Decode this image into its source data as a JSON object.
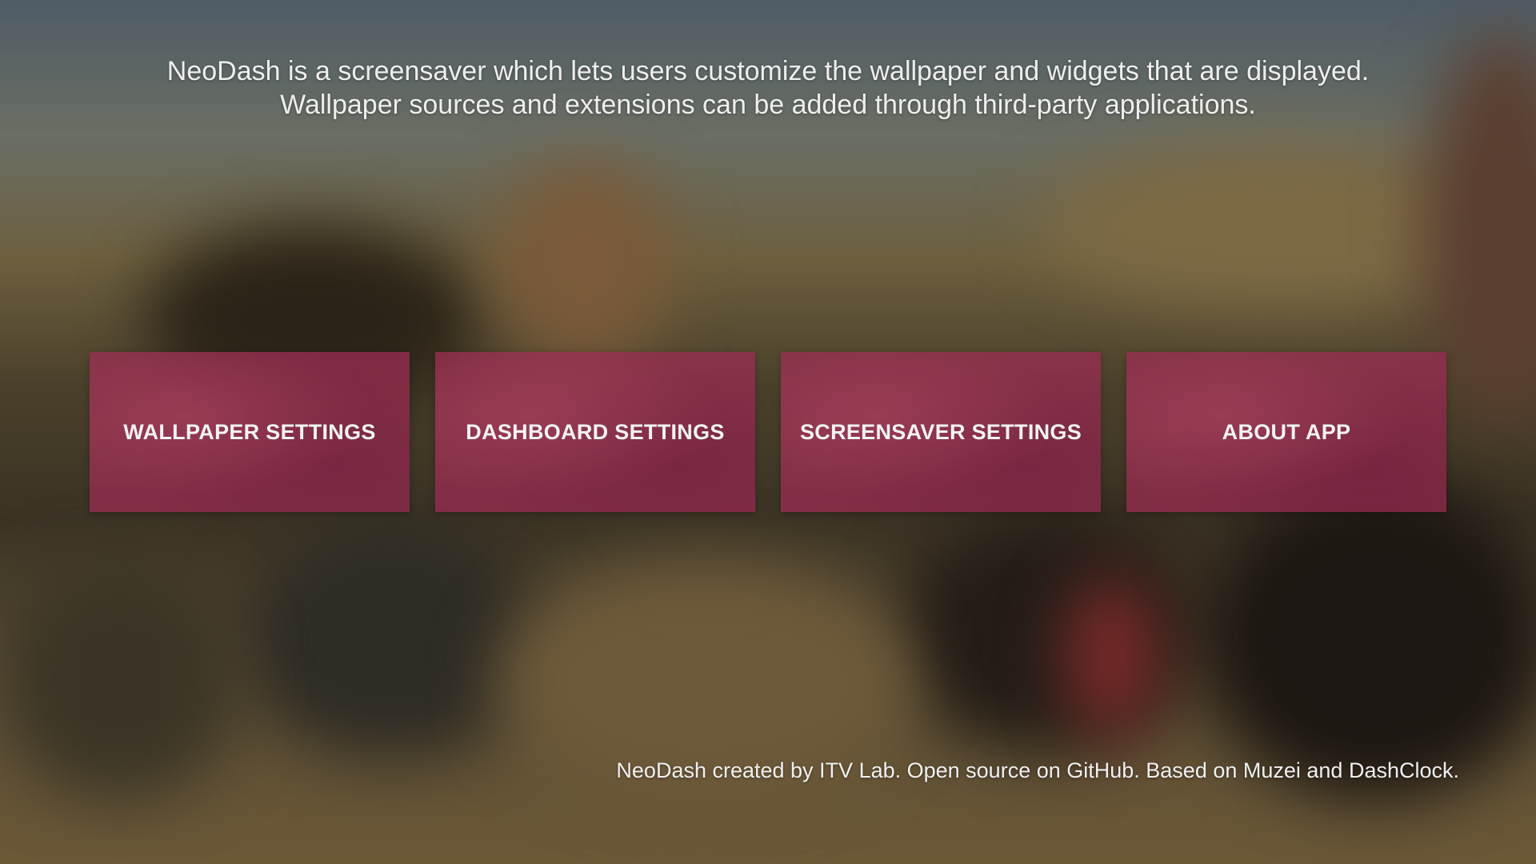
{
  "description": {
    "line1": "NeoDash is a screensaver which lets users customize the wallpaper and widgets that are displayed.",
    "line2": "Wallpaper sources and extensions can be added through third-party applications."
  },
  "buttons": [
    {
      "label": "WALLPAPER SETTINGS"
    },
    {
      "label": "DASHBOARD SETTINGS"
    },
    {
      "label": "SCREENSAVER SETTINGS"
    },
    {
      "label": "ABOUT APP"
    }
  ],
  "footer": {
    "text": "NeoDash created by ITV Lab. Open source on GitHub. Based on Muzei and DashClock."
  },
  "colors": {
    "tile": "#962d50",
    "text": "#f2f2f2"
  }
}
